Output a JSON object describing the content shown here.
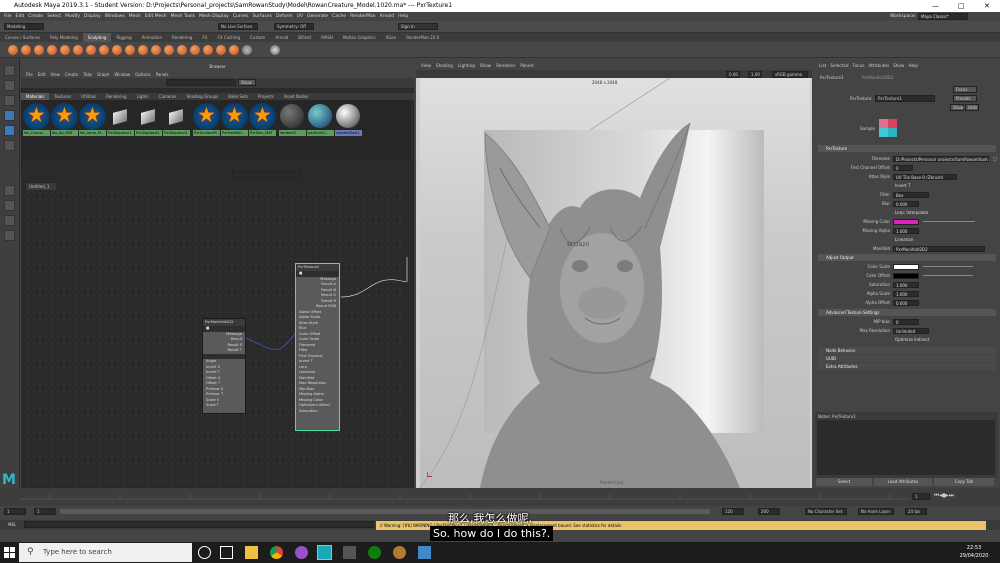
{
  "window": {
    "title": "Autodesk Maya 2019.3.1 - Student Version: D:\\Projects\\Personal_projects\\SamRowanStudy\\Model\\RowanCreature_Model.1020.ma*  ---  PxrTexture1",
    "workspace": "Maya Classic*"
  },
  "menubar": [
    "File",
    "Edit",
    "Create",
    "Select",
    "Modify",
    "Display",
    "Windows",
    "Mesh",
    "Edit Mesh",
    "Mesh Tools",
    "Mesh Display",
    "Curves",
    "Surfaces",
    "Deform",
    "UV",
    "Generate",
    "Cache",
    "RenderMan",
    "Arnold",
    "Help"
  ],
  "statusline": {
    "mode": "Modeling",
    "live": "No Live Surface",
    "symmetry": "Symmetry: Off",
    "signin": "Sign In"
  },
  "shelf_tabs": [
    "Curves / Surfaces",
    "Poly Modeling",
    "Sculpting",
    "Rigging",
    "Animation",
    "Rendering",
    "FX",
    "FX Caching",
    "Custom",
    "Arnold",
    "Bifrost",
    "MASH",
    "Motion Graphics",
    "XGen",
    "RenderMan 23.0"
  ],
  "shelf_active": "Sculpting",
  "hypershade": {
    "title": "Browser",
    "menu": [
      "File",
      "Edit",
      "View",
      "Create",
      "Tabs",
      "Graph",
      "Window",
      "Options",
      "Panels"
    ],
    "show_button": "Show",
    "tabs": [
      "Materials",
      "Textures",
      "Utilities",
      "Rendering",
      "Lights",
      "Cameras",
      "Shading Groups",
      "Bake Sets",
      "Projects",
      "Asset Nodes"
    ],
    "materials": [
      "lbs_Conca...",
      "lbs_Ao_MAT",
      "lbs_lamb_M...",
      "PxrDisplace1",
      "PxrDisplace2",
      "PxrDisplace3",
      "PxrSurfaceM...",
      "PxrHairMar...",
      "PxrSkin_MAT",
      "lambert1",
      "particleCl...",
      "shaderGlow1"
    ],
    "graph_tab": "Untitled_1"
  },
  "node_manifold": {
    "title": "PxrManifold2D2",
    "outputs": [
      "Message",
      "Result",
      "Result S",
      "Result T"
    ],
    "inputs": [
      "Angle",
      "Invert S",
      "Invert T",
      "Offset S",
      "Offset T",
      "Primvar S",
      "Primvar T",
      "Scale S",
      "Scale T"
    ]
  },
  "node_texture": {
    "title": "PxrTexture1",
    "outputs": [
      "Message",
      "Result A",
      "Result B",
      "Result G",
      "Result R",
      "Result RGB"
    ],
    "inputs": [
      "Alpha Offset",
      "Alpha Scale",
      "Atlas Style",
      "Blur",
      "Color Offset",
      "Color Scale",
      "Filename",
      "Filter",
      "First Channel",
      "Invert T",
      "Lerp",
      "Linearize",
      "Manifold",
      "Max Resolution",
      "Mip Bias",
      "Missing Alpha",
      "Missing Color",
      "Optimize Indirect",
      "Saturation"
    ]
  },
  "viewport": {
    "menu": [
      "View",
      "Shading",
      "Lighting",
      "Show",
      "Renderer",
      "Panels"
    ],
    "resolution": "2048 x 2048",
    "gamma": "sRGB gamma",
    "val1": "0.00",
    "val2": "1.00",
    "hud_label": "50.115(27)",
    "camera": "RenderCam"
  },
  "attr_editor": {
    "menu": [
      "List",
      "Selected",
      "Focus",
      "Attributes",
      "Show",
      "Help"
    ],
    "tabs": [
      "PxrTexture1",
      "PxrManifold2D2"
    ],
    "node_label": "PxrTexture:",
    "node_value": "PxrTexture1",
    "buttons": [
      "Focus",
      "Presets",
      "Show",
      "Hide"
    ],
    "sample_label": "Sample",
    "section_main": "PxrTexture",
    "filename_label": "Filename",
    "filename": "D:/Projects/Personal_projects/SamRowanStudy/...",
    "fields": [
      {
        "label": "First Channel Offset",
        "value": "0"
      },
      {
        "label": "Atlas Style",
        "value": "UV Tile Base-0 (Zbrush)"
      },
      {
        "label": "",
        "value": "Invert T"
      },
      {
        "label": "Filter",
        "value": "Box"
      },
      {
        "label": "Blur",
        "value": "0.000"
      },
      {
        "label": "",
        "value": "Lerp: Interpolate"
      },
      {
        "label": "Missing Color",
        "value": ""
      },
      {
        "label": "Missing Alpha",
        "value": "1.000"
      },
      {
        "label": "",
        "value": "Linearize"
      },
      {
        "label": "Manifold",
        "value": "PxrManifold2D2"
      }
    ],
    "section_adjust": "Adjust Output",
    "adjust": [
      {
        "label": "Color Scale",
        "value": ""
      },
      {
        "label": "Color Offset",
        "value": ""
      },
      {
        "label": "Saturation",
        "value": "1.000"
      },
      {
        "label": "Alpha Scale",
        "value": "1.000"
      },
      {
        "label": "Alpha Offset",
        "value": "0.000"
      }
    ],
    "section_adv": "Advanced Texture Settings",
    "adv": [
      {
        "label": "MIP bias",
        "value": "0"
      },
      {
        "label": "Max Resolution",
        "value": "Unlimited"
      },
      {
        "label": "",
        "value": "Optimize Indirect"
      }
    ],
    "collapsed": [
      "Node Behavior",
      "UUID",
      "Extra Attributes"
    ],
    "notes": "Notes:  PxrTexture1",
    "bottom_buttons": [
      "Select",
      "Load Attributes",
      "Copy Tab"
    ]
  },
  "timeline": {
    "start": "1",
    "end": "120",
    "current": "1",
    "range_start": "1",
    "range_end": "120",
    "range_max": "200",
    "character_set": "No Character Set",
    "anim_layer": "No Anim Layer",
    "fps": "24 fps"
  },
  "cmd": {
    "label": "MEL",
    "warning": "// Warning: [tfb] WARNING | PxrDisplace1 / displacement : displacement > displacement bound. See statistics for details."
  },
  "subtitles": {
    "zh": "那么,我怎么做呢,",
    "en": "So. how do I do this?."
  },
  "taskbar": {
    "search_placeholder": "Type here to search",
    "time": "22:53",
    "date": "29/04/2020"
  },
  "colors": {
    "accent": "#3a7ab8",
    "missing_color": "#e020c0",
    "warning_bg": "#e9c46a"
  }
}
